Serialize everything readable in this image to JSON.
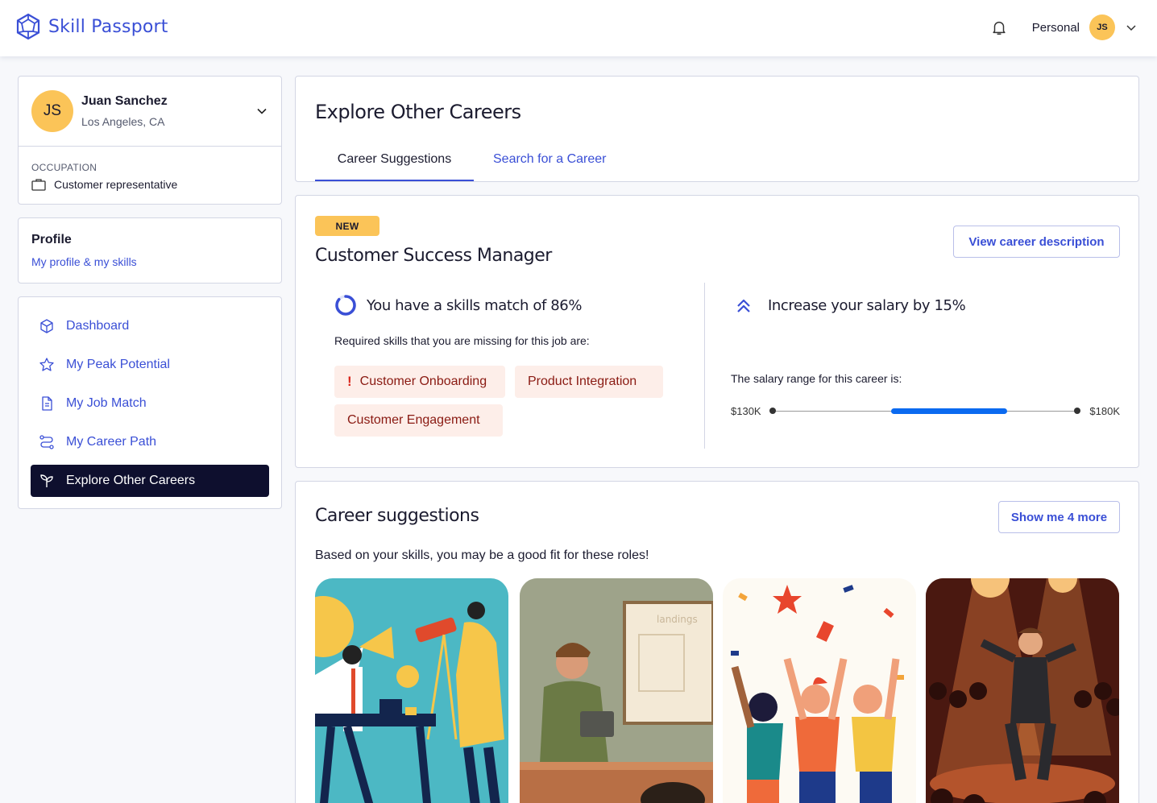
{
  "app": {
    "name": "Skill Passport"
  },
  "topbar": {
    "account_label": "Personal",
    "avatar_initials": "JS"
  },
  "user": {
    "initials": "JS",
    "name": "Juan Sanchez",
    "location": "Los Angeles, CA",
    "occupation_label": "OCCUPATION",
    "occupation": "Customer representative"
  },
  "profile": {
    "title": "Profile",
    "link": "My profile & my skills"
  },
  "nav": {
    "items": [
      {
        "label": "Dashboard",
        "icon": "cube-icon"
      },
      {
        "label": "My Peak Potential",
        "icon": "star-icon"
      },
      {
        "label": "My Job Match",
        "icon": "document-icon"
      },
      {
        "label": "My Career Path",
        "icon": "path-icon"
      },
      {
        "label": "Explore Other Careers",
        "icon": "sprout-icon",
        "active": true
      }
    ]
  },
  "header": {
    "title": "Explore Other Careers",
    "tabs": [
      {
        "label": "Career Suggestions",
        "active": true
      },
      {
        "label": "Search for a Career"
      }
    ]
  },
  "career": {
    "badge": "NEW",
    "title": "Customer Success Manager",
    "view_button": "View career description",
    "match_text": "You have a skills match of 86%",
    "match_percent": 86,
    "missing_text": "Required skills that you are missing for this job are:",
    "missing_skills": [
      "Customer Onboarding",
      "Product Integration",
      "Customer Engagement"
    ],
    "salary_text": "Increase your salary by 15%",
    "range_label": "The salary range for this career is:",
    "range_min": "$130K",
    "range_max": "$180K",
    "range_highlight": [
      0.39,
      0.77
    ]
  },
  "suggestions": {
    "title": "Career suggestions",
    "more_button": "Show me 4 more",
    "subtitle": "Based on your skills, you may be a good fit for these roles!",
    "thumb_sign": "landings"
  },
  "colors": {
    "accent": "#3a4fd6",
    "avatar": "#fbc458",
    "nav_active": "#0e0f2e",
    "chip_bg": "#fdeee9",
    "bar": "#0b6af0"
  }
}
